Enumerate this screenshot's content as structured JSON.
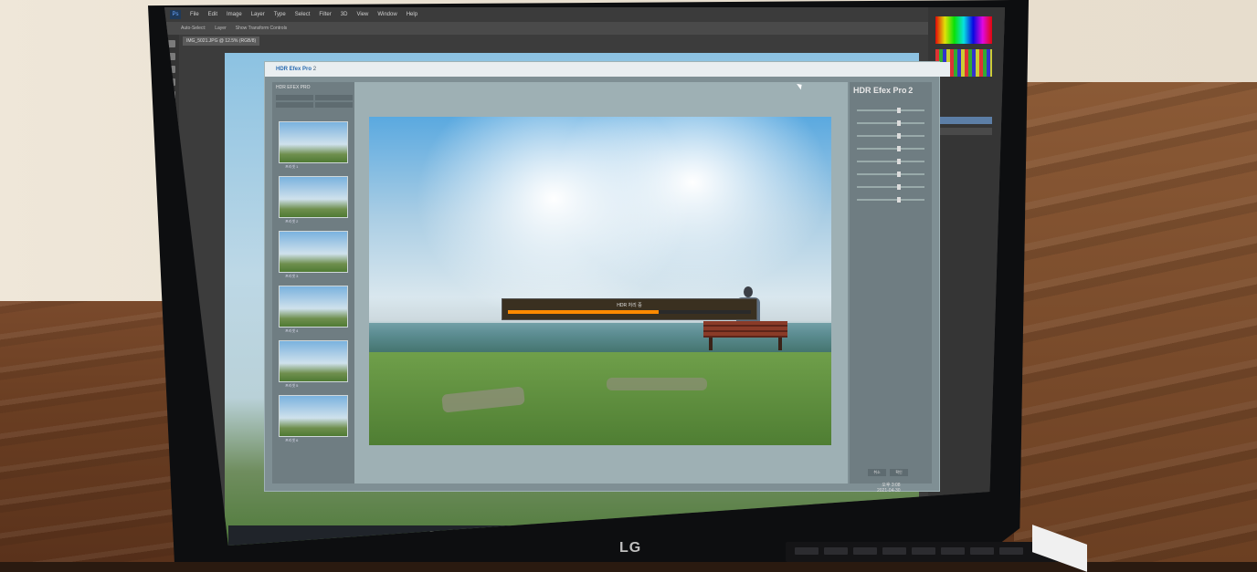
{
  "brand": {
    "laptop_logo": "LG"
  },
  "photoshop": {
    "app_icon": "Ps",
    "menu": [
      "File",
      "Edit",
      "Image",
      "Layer",
      "Type",
      "Select",
      "Filter",
      "3D",
      "View",
      "Window",
      "Help"
    ],
    "options": [
      "Auto-Select:",
      "Layer",
      "Show Transform Controls"
    ],
    "document_tab": "IMG_5021.JPG @ 12.5% (RGB/8)"
  },
  "plugin": {
    "title_brand": "HDR Efex Pro",
    "title_suffix": "2",
    "left_header": "HDR EFEX PRO",
    "right_title": "HDR Efex Pro",
    "right_title_num": "2",
    "progress": {
      "label": "HDR 처리 중",
      "fraction": 0.62,
      "fill_color": "#ff8a00"
    },
    "thumb_labels": [
      "프리셋 1",
      "프리셋 2",
      "프리셋 3",
      "프리셋 4",
      "프리셋 5",
      "프리셋 6"
    ],
    "buttons": [
      "취소",
      "확인"
    ]
  },
  "taskbar": {
    "icons": [
      "search-icon",
      "task-view-icon",
      "edge-icon",
      "file-explorer-icon",
      "store-icon",
      "mail-icon",
      "photoshop-icon"
    ],
    "icon_colors": [
      "#cfcfcf",
      "#cfcfcf",
      "#2f9be0",
      "#f0c040",
      "#d0d0d0",
      "#3b7fd4",
      "#5aa0ff"
    ],
    "clock": "오후 3:08",
    "date": "2021-04-30"
  }
}
